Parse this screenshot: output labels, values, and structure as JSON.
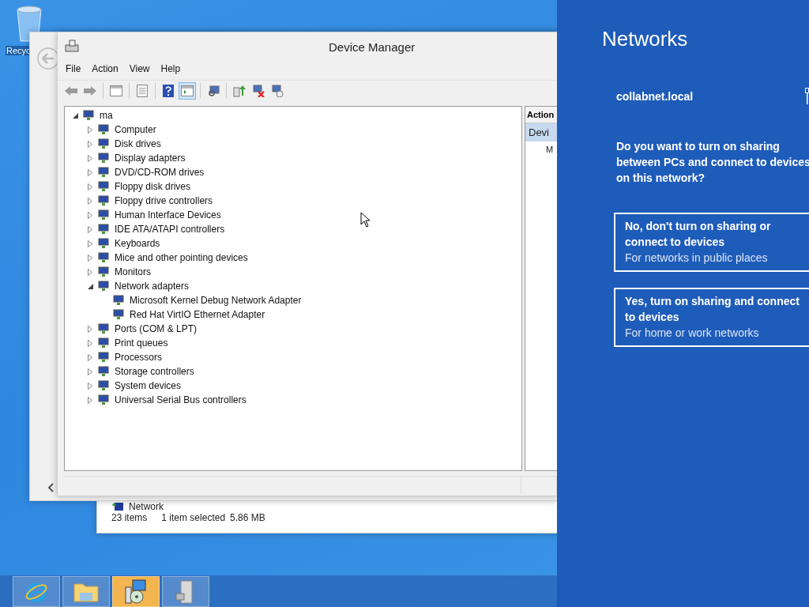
{
  "desktop": {
    "icons": [
      {
        "label": "Recyc"
      }
    ]
  },
  "explorer_window": {
    "row": "Network",
    "status_bar": [
      "23 items",
      "1 item selected",
      "5.86 MB"
    ]
  },
  "device_manager": {
    "title": "Device Manager",
    "menu": [
      "File",
      "Action",
      "View",
      "Help"
    ],
    "toolbar": [
      {
        "kind": "back",
        "selected": false
      },
      {
        "kind": "forward",
        "selected": false
      },
      {
        "kind": "sep"
      },
      {
        "kind": "tree",
        "selected": false
      },
      {
        "kind": "sep"
      },
      {
        "kind": "properties",
        "selected": false
      },
      {
        "kind": "sep"
      },
      {
        "kind": "help",
        "selected": false
      },
      {
        "kind": "pane",
        "selected": true
      },
      {
        "kind": "sep"
      },
      {
        "kind": "scan",
        "selected": false
      },
      {
        "kind": "sep"
      },
      {
        "kind": "update",
        "selected": false
      },
      {
        "kind": "uninstall",
        "selected": false
      },
      {
        "kind": "add",
        "selected": false
      }
    ],
    "tree": {
      "label": "ma",
      "expanded": true,
      "children": [
        {
          "label": "Computer",
          "expanded": false
        },
        {
          "label": "Disk drives",
          "expanded": false
        },
        {
          "label": "Display adapters",
          "expanded": false
        },
        {
          "label": "DVD/CD-ROM drives",
          "expanded": false
        },
        {
          "label": "Floppy disk drives",
          "expanded": false
        },
        {
          "label": "Floppy drive controllers",
          "expanded": false
        },
        {
          "label": "Human Interface Devices",
          "expanded": false
        },
        {
          "label": "IDE ATA/ATAPI controllers",
          "expanded": false
        },
        {
          "label": "Keyboards",
          "expanded": false
        },
        {
          "label": "Mice and other pointing devices",
          "expanded": false
        },
        {
          "label": "Monitors",
          "expanded": false
        },
        {
          "label": "Network adapters",
          "expanded": true,
          "children": [
            {
              "label": "Microsoft Kernel Debug Network Adapter"
            },
            {
              "label": "Red Hat VirtIO Ethernet Adapter"
            }
          ]
        },
        {
          "label": "Ports (COM & LPT)",
          "expanded": false
        },
        {
          "label": "Print queues",
          "expanded": false
        },
        {
          "label": "Processors",
          "expanded": false
        },
        {
          "label": "Storage controllers",
          "expanded": false
        },
        {
          "label": "System devices",
          "expanded": false
        },
        {
          "label": "Universal Serial Bus controllers",
          "expanded": false
        }
      ]
    },
    "action_pane": {
      "header": "Action",
      "items": [
        {
          "label": "Devi",
          "selected": true
        },
        {
          "label": "M",
          "selected": false
        }
      ]
    }
  },
  "networks_pane": {
    "title": "Networks",
    "network": "collabnet.local",
    "question": "Do you want to turn on sharing between PCs and connect to devices on this network?",
    "options": [
      {
        "title": "No, don't turn on sharing or connect to devices",
        "subtitle": "For networks in public places",
        "selected": false
      },
      {
        "title": "Yes, turn on sharing and connect to devices",
        "subtitle": "For home or work networks",
        "selected": false
      }
    ]
  },
  "taskbar": {
    "items": [
      {
        "kind": "browser",
        "selected": false
      },
      {
        "kind": "folder",
        "selected": false
      },
      {
        "kind": "setup",
        "selected": true
      },
      {
        "kind": "server",
        "selected": false
      }
    ]
  }
}
